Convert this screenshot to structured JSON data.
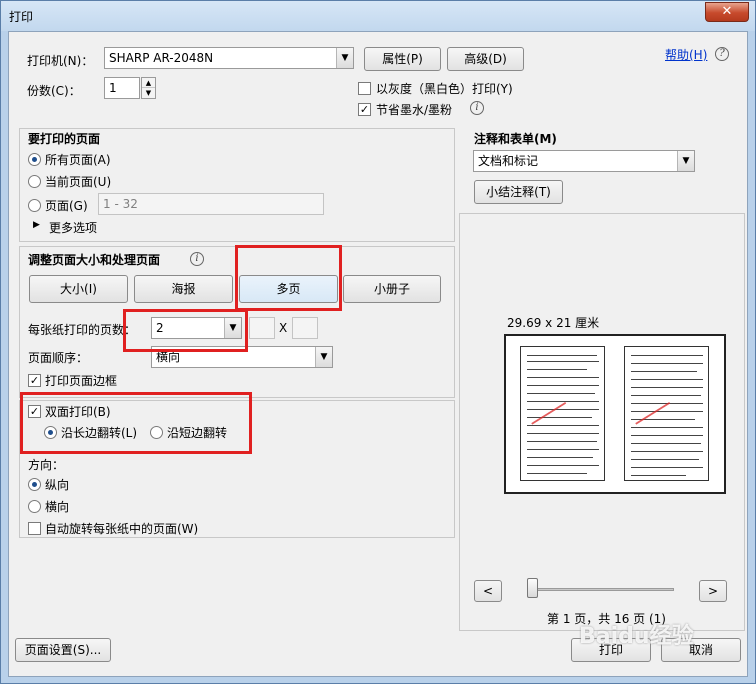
{
  "window": {
    "title": "打印",
    "close_glyph": "✕"
  },
  "printer": {
    "label": "打印机(N)：",
    "selected": "SHARP AR-2048N",
    "properties_button": "属性(P)",
    "advanced_button": "高级(D)",
    "help_link": "帮助(H)",
    "copies_label": "份数(C)：",
    "copies_value": "1",
    "grayscale_label": "以灰度（黑白色）打印(Y)",
    "grayscale_checked": false,
    "save_ink_label": "节省墨水/墨粉",
    "save_ink_checked": true
  },
  "pages_to_print": {
    "heading": "要打印的页面",
    "all_pages": "所有页面(A)",
    "current_page": "当前页面(U)",
    "pages_label": "页面(G)",
    "pages_range_placeholder": "1 - 32",
    "more_options": "更多选项",
    "selected": "all_pages"
  },
  "page_handling": {
    "heading": "调整页面大小和处理页面",
    "tabs": [
      "大小(I)",
      "海报",
      "多页",
      "小册子"
    ],
    "active_tab": "多页",
    "pages_per_sheet_label": "每张纸打印的页数：",
    "pages_per_sheet_value": "2",
    "custom_x_label": "X",
    "page_order_label": "页面顺序：",
    "page_order_value": "横向",
    "print_border_label": "打印页面边框",
    "print_border_checked": true
  },
  "duplex": {
    "label": "双面打印(B)",
    "checked": true,
    "long_edge": "沿长边翻转(L)",
    "short_edge": "沿短边翻转",
    "selected": "long_edge"
  },
  "orientation": {
    "label": "方向：",
    "portrait": "纵向",
    "landscape": "横向",
    "selected": "portrait",
    "auto_rotate_label": "自动旋转每张纸中的页面(W)",
    "auto_rotate_checked": false
  },
  "comments": {
    "heading": "注释和表单(M)",
    "selected": "文档和标记",
    "summarize_button": "小结注释(T)"
  },
  "preview": {
    "size_text": "29.69 x 21 厘米",
    "prev_glyph": "<",
    "next_glyph": ">",
    "page_status": "第 1 页，共 16 页 (1)"
  },
  "footer": {
    "page_setup_button": "页面设置(S)...",
    "print_button": "打印",
    "cancel_button": "取消"
  },
  "watermark": {
    "text": "Baidu经验"
  },
  "colors": {
    "highlight_box": "#e02020",
    "link": "#0033cc",
    "window_frame": "#b9d1ea"
  }
}
